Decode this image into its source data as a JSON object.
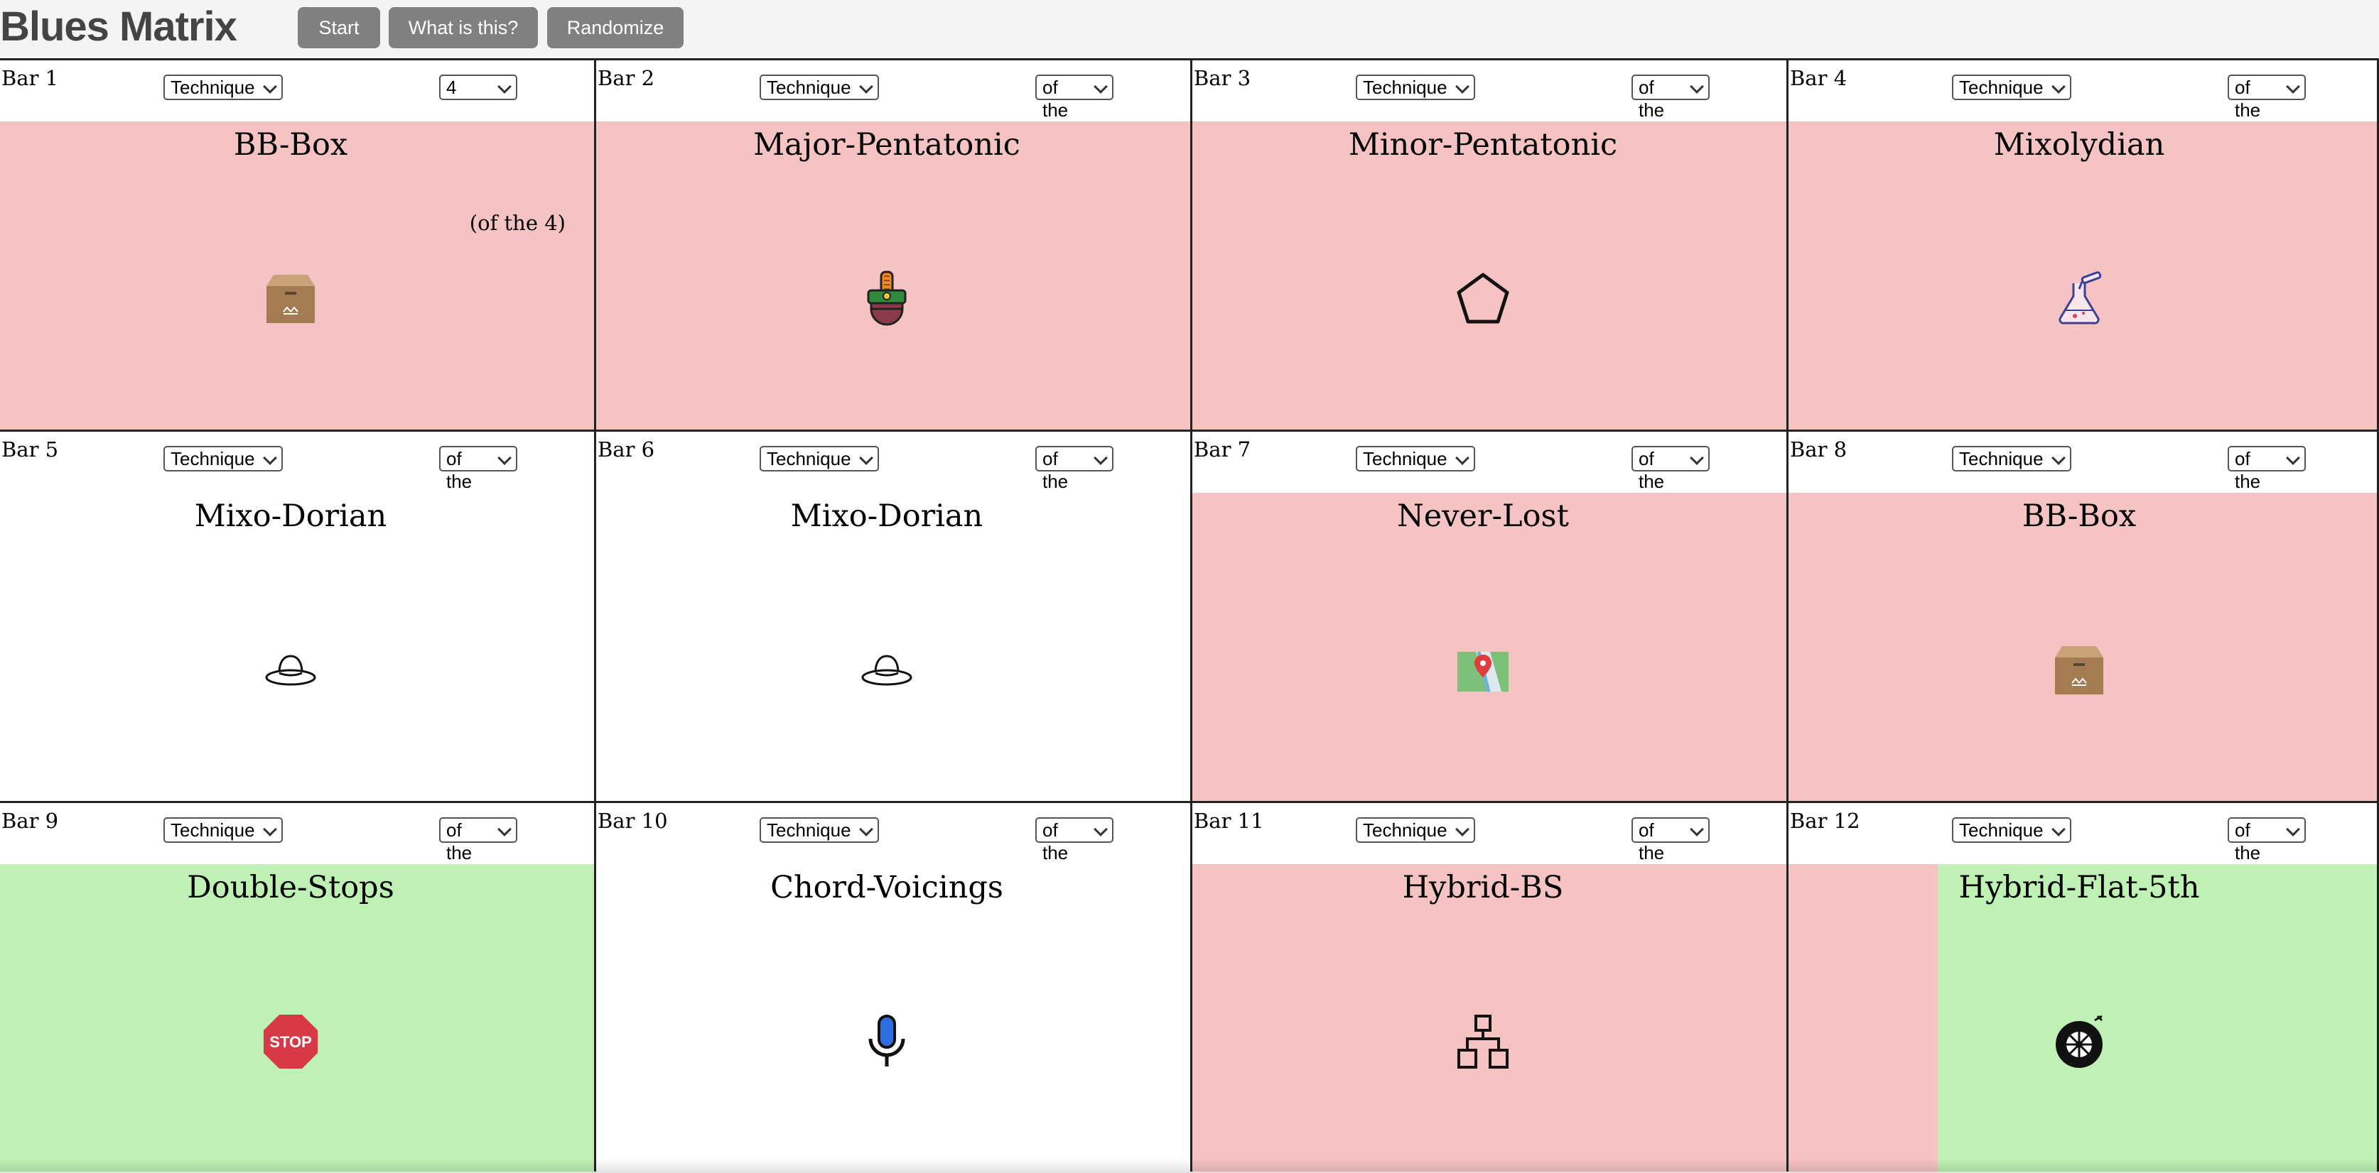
{
  "header": {
    "title": "Blues Matrix",
    "buttons": {
      "start": "Start",
      "what": "What is this?",
      "randomize": "Randomize"
    }
  },
  "colors": {
    "red_cell": "#f5c3c2",
    "green_cell": "#bff0b4",
    "white_cell": "#ffffff",
    "button_bg": "#808080"
  },
  "bars": [
    {
      "label": "Bar 1",
      "technique_select": "Technique",
      "of_select": "4",
      "name": "BB-Box",
      "note": "(of the 4)",
      "icon": "cardboard-box-icon",
      "color": "red"
    },
    {
      "label": "Bar 2",
      "technique_select": "Technique",
      "of_select": "of the",
      "name": "Major-Pentatonic",
      "note": "",
      "icon": "guard-soldier-icon",
      "color": "red"
    },
    {
      "label": "Bar 3",
      "technique_select": "Technique",
      "of_select": "of the",
      "name": "Minor-Pentatonic",
      "note": "",
      "icon": "pentagon-icon",
      "color": "red"
    },
    {
      "label": "Bar 4",
      "technique_select": "Technique",
      "of_select": "of the",
      "name": "Mixolydian",
      "note": "",
      "icon": "lab-flask-icon",
      "color": "red"
    },
    {
      "label": "Bar 5",
      "technique_select": "Technique",
      "of_select": "of the",
      "name": "Mixo-Dorian",
      "note": "",
      "icon": "hat-icon",
      "color": "white"
    },
    {
      "label": "Bar 6",
      "technique_select": "Technique",
      "of_select": "of the",
      "name": "Mixo-Dorian",
      "note": "",
      "icon": "hat-icon",
      "color": "white"
    },
    {
      "label": "Bar 7",
      "technique_select": "Technique",
      "of_select": "of the",
      "name": "Never-Lost",
      "note": "",
      "icon": "map-pin-icon",
      "color": "red"
    },
    {
      "label": "Bar 8",
      "technique_select": "Technique",
      "of_select": "of the",
      "name": "BB-Box",
      "note": "",
      "icon": "cardboard-box-icon",
      "color": "red"
    },
    {
      "label": "Bar 9",
      "technique_select": "Technique",
      "of_select": "of the",
      "name": "Double-Stops",
      "note": "",
      "icon": "stop-sign-icon",
      "color": "green"
    },
    {
      "label": "Bar 10",
      "technique_select": "Technique",
      "of_select": "of the",
      "name": "Chord-Voicings",
      "note": "",
      "icon": "microphone-icon",
      "color": "white"
    },
    {
      "label": "Bar 11",
      "technique_select": "Technique",
      "of_select": "of the",
      "name": "Hybrid-BS",
      "note": "",
      "icon": "hierarchy-icon",
      "color": "red"
    },
    {
      "label": "Bar 12",
      "technique_select": "Technique",
      "of_select": "of the",
      "name": "Hybrid-Flat-5th",
      "note": "",
      "icon": "tire-icon",
      "color": "split"
    }
  ]
}
